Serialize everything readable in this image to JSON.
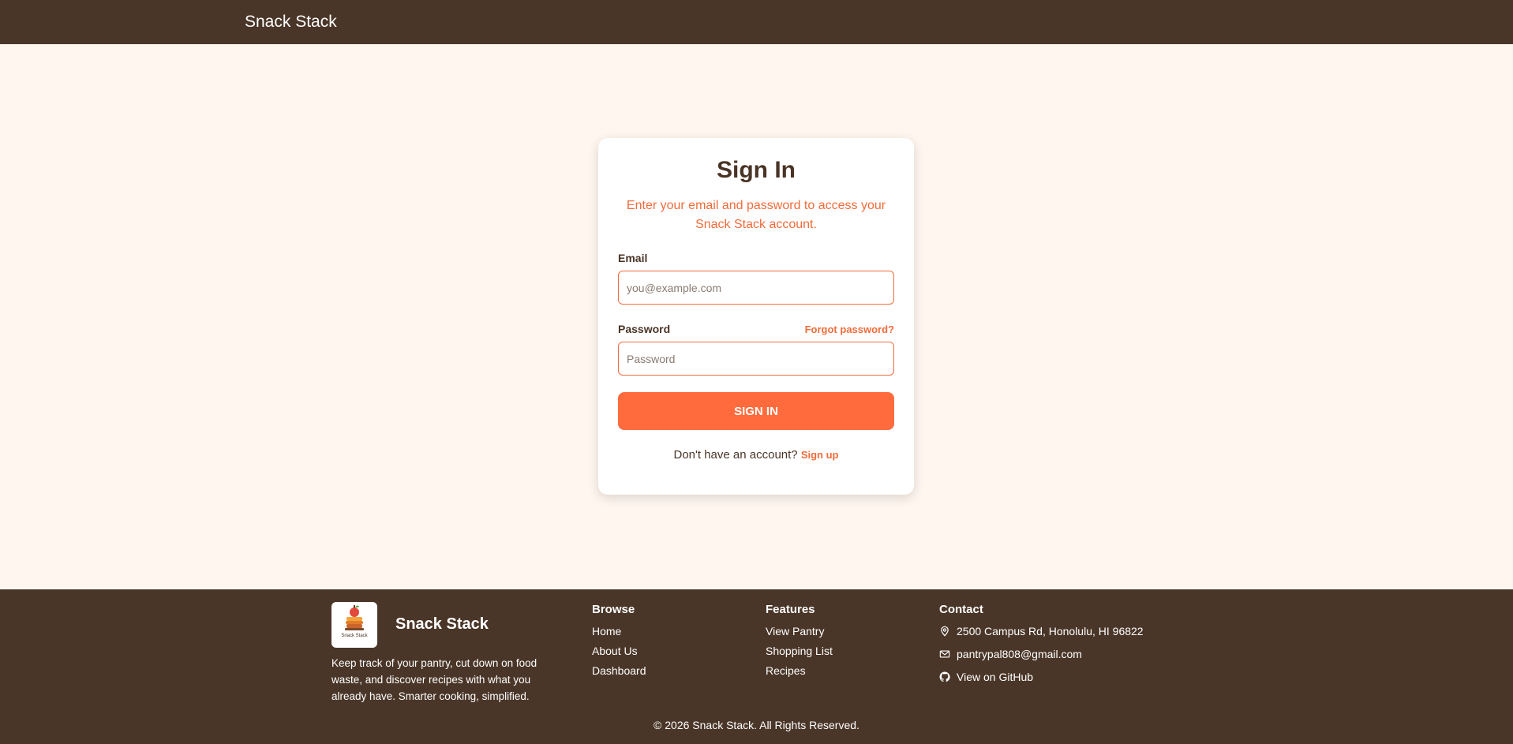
{
  "navbar": {
    "brand": "Snack Stack"
  },
  "signin": {
    "title": "Sign In",
    "subtitle": "Enter your email and password to access your Snack Stack account.",
    "email_label": "Email",
    "email_placeholder": "you@example.com",
    "password_label": "Password",
    "forgot_label": "Forgot password?",
    "password_placeholder": "Password",
    "button_label": "SIGN IN",
    "no_account_text": "Don't have an account?",
    "signup_label": "Sign up"
  },
  "footer": {
    "brand": "Snack Stack",
    "logo_caption": "Snack Stack",
    "description": "Keep track of your pantry, cut down on food waste, and discover recipes with what you already have. Smarter cooking, simplified.",
    "browse": {
      "title": "Browse",
      "links": [
        "Home",
        "About Us",
        "Dashboard"
      ]
    },
    "features": {
      "title": "Features",
      "links": [
        "View Pantry",
        "Shopping List",
        "Recipes"
      ]
    },
    "contact": {
      "title": "Contact",
      "address": "2500 Campus Rd, Honolulu, HI 96822",
      "email": "pantrypal808@gmail.com",
      "github": "View on GitHub",
      "icons": [
        "map-pin-icon",
        "mail-icon",
        "github-icon"
      ]
    },
    "copyright": "© 2026 Snack Stack. All Rights Reserved."
  },
  "colors": {
    "nav_bg": "#4a3628",
    "page_bg": "#fff6ef",
    "accent": "#ff6b3d",
    "text_dark": "#4a3426"
  }
}
